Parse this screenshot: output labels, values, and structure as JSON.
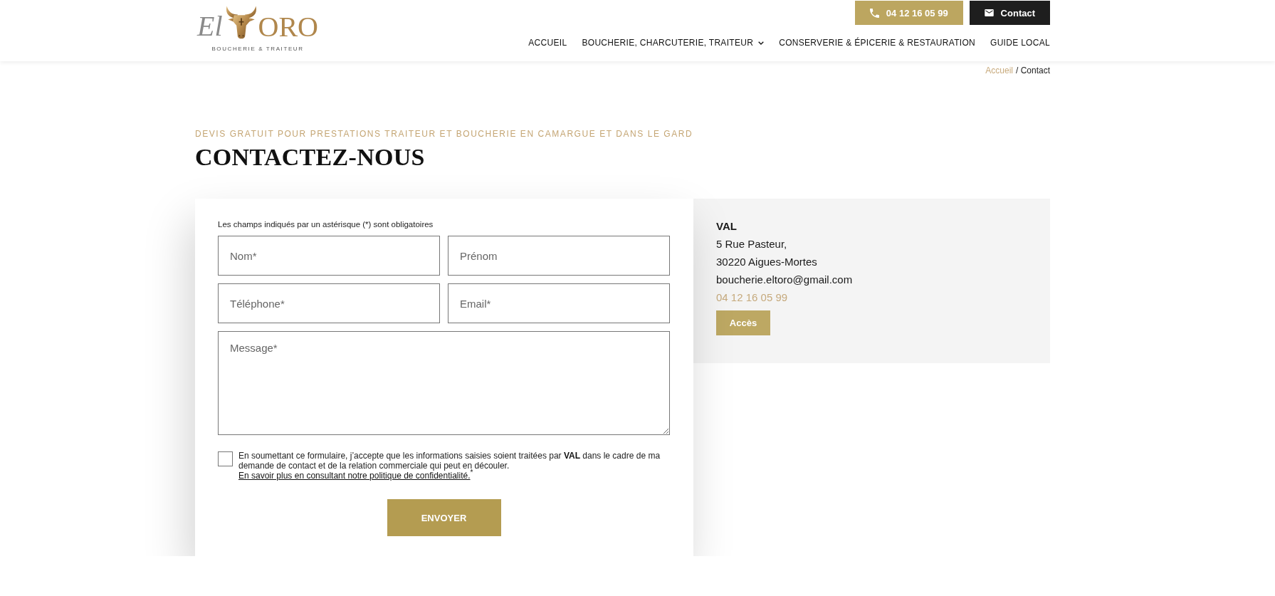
{
  "header": {
    "logo": {
      "script": "El",
      "wordmark": "ORO",
      "tagline": "BOUCHERIE & TRAITEUR"
    },
    "buttons": [
      {
        "label": "04 12 16 05 99",
        "kind": "phone"
      },
      {
        "label": "Contact",
        "kind": "mail"
      }
    ],
    "nav": [
      {
        "label": "ACCUEIL",
        "submenu": false
      },
      {
        "label": "BOUCHERIE, CHARCUTERIE, TRAITEUR",
        "submenu": true
      },
      {
        "label": "CONSERVERIE & ÉPICERIE & RESTAURATION",
        "submenu": false
      },
      {
        "label": "GUIDE LOCAL",
        "submenu": false
      }
    ]
  },
  "breadcrumb": {
    "link": "Accueil",
    "current": "/ Contact"
  },
  "intro": {
    "kicker": "DEVIS GRATUIT POUR PRESTATIONS TRAITEUR ET BOUCHERIE EN CAMARGUE ET DANS LE GARD",
    "title": "CONTACTEZ-NOUS"
  },
  "form": {
    "note": "Les champs indiqués par un astérisque (*) sont obligatoires",
    "fields": [
      {
        "kind": "input",
        "placeholder": "Nom*"
      },
      {
        "kind": "input",
        "placeholder": "Prénom"
      },
      {
        "kind": "input",
        "placeholder": "Téléphone*"
      },
      {
        "kind": "input",
        "placeholder": "Email*"
      },
      {
        "kind": "textarea",
        "placeholder": "Message*"
      }
    ],
    "consent": {
      "checked": false,
      "text": "En soumettant ce formulaire, j’accepte que les informations saisies soient traitées par **VAL** dans le cadre de ma demande de contact et de la relation commerciale qui peut en découler.",
      "link": "En savoir plus en consultant notre politique de confidentialité.",
      "mark": "$^{*}$"
    },
    "submit": "ENVOYER"
  },
  "contact_card": {
    "name": "VAL",
    "lines": [
      "5 Rue Pasteur,",
      "30220 Aigues-Mortes",
      "boucherie.eltoro@gmail.com"
    ],
    "phone": "04 12 16 05 99",
    "button": "Accès"
  }
}
